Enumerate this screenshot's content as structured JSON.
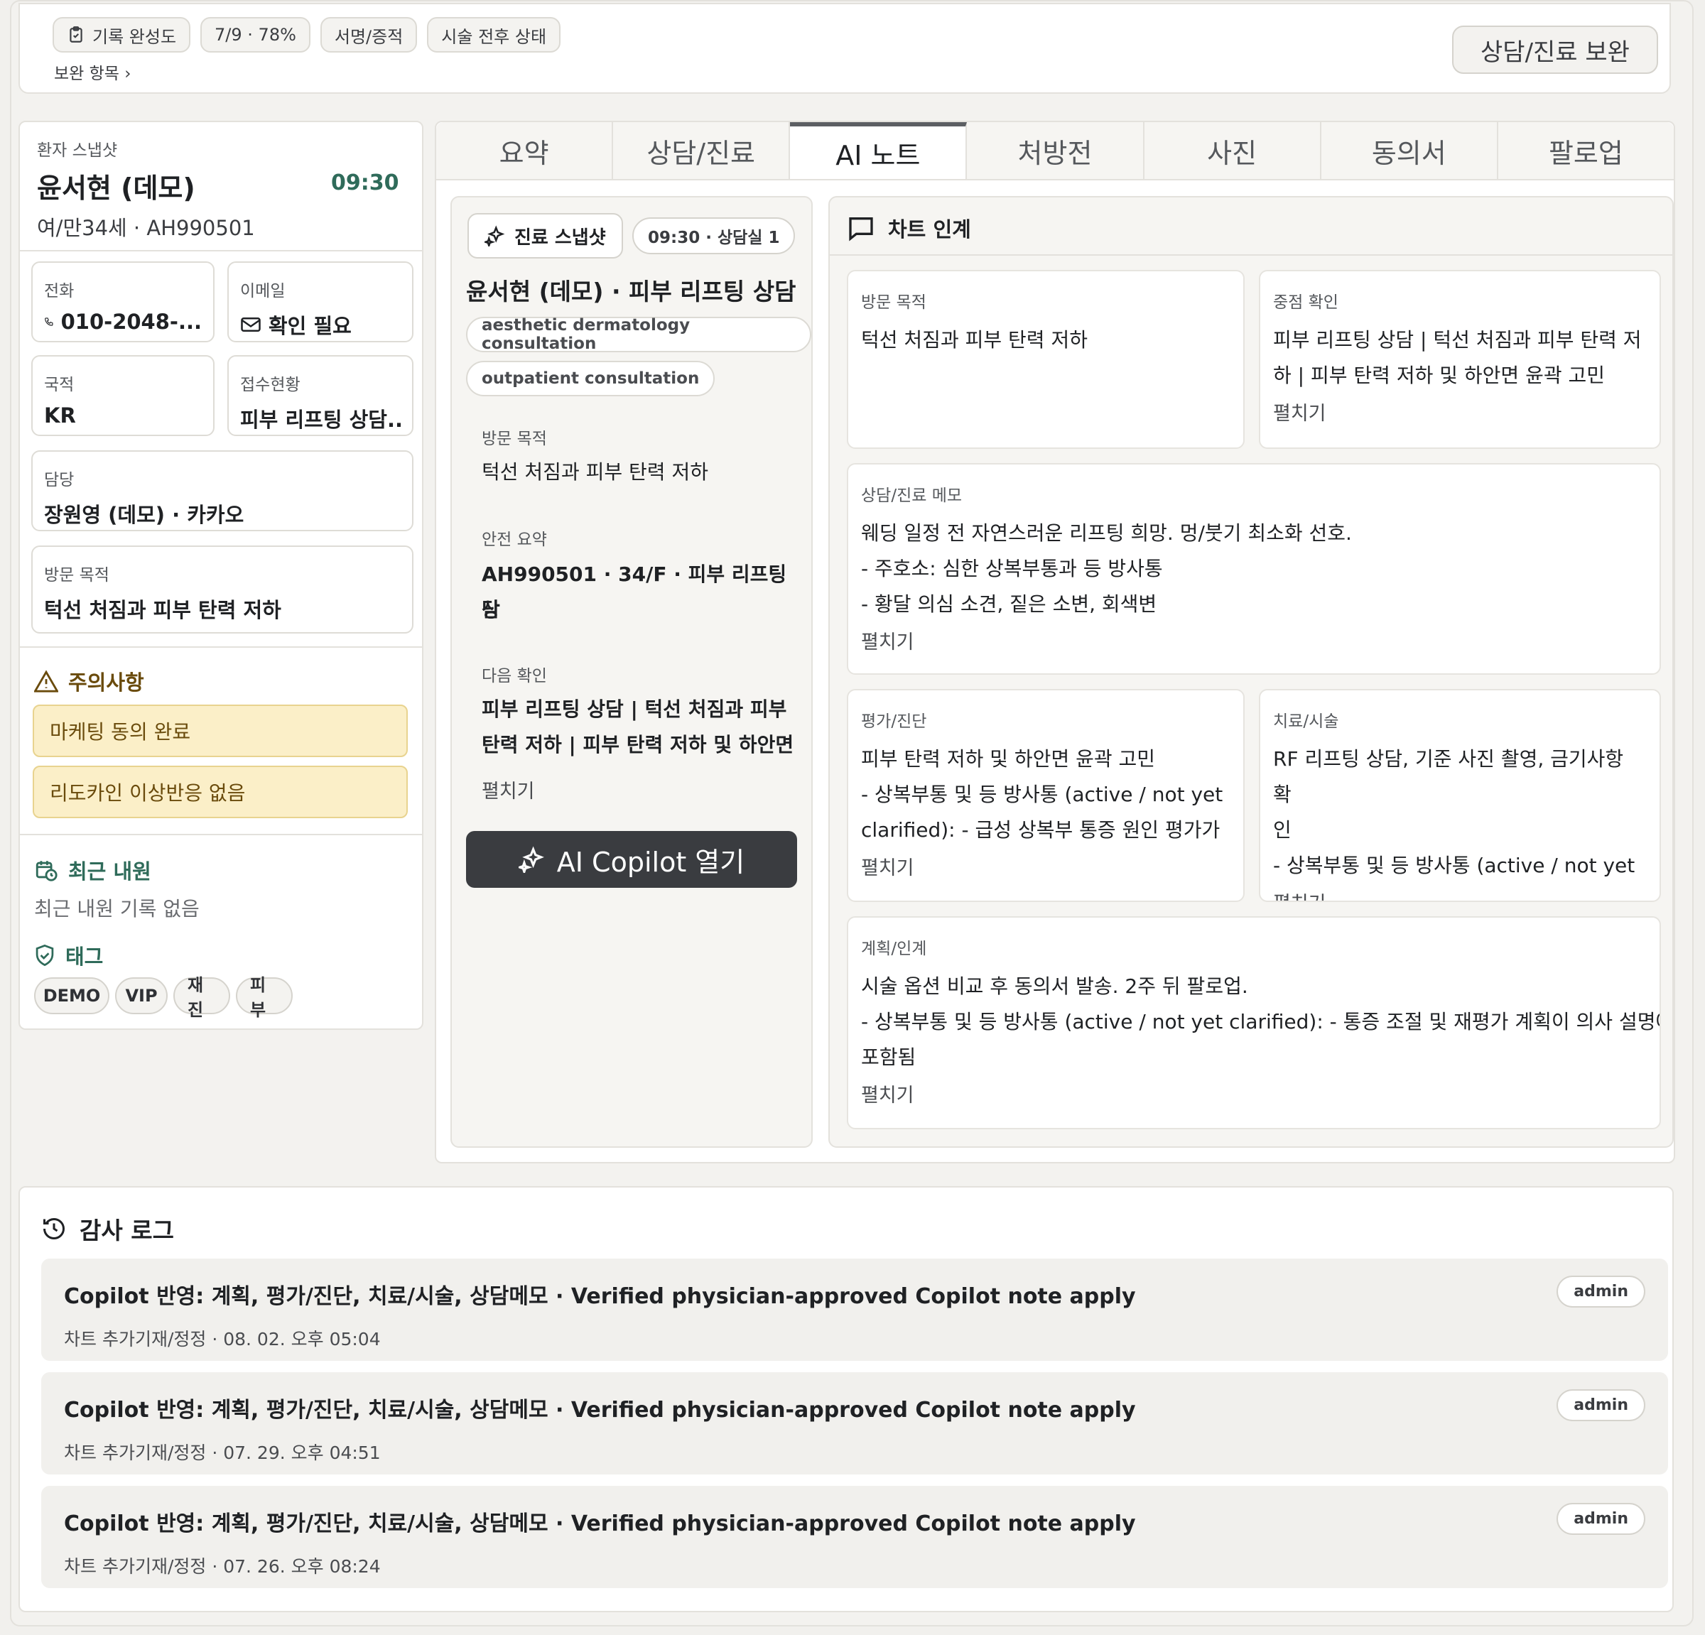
{
  "top_bar": {
    "pills": [
      "기록 완성도",
      "7/9 · 78%",
      "서명/증적",
      "시술 전후 상태"
    ],
    "supplement_link": "보완 항목 ›",
    "supplement_button": "상담/진료 보완"
  },
  "patient": {
    "section_label": "환자 스냅샷",
    "name": "윤서현 (데모)",
    "time": "09:30",
    "meta": "여/만34세 · AH990501",
    "fields": {
      "phone_label": "전화",
      "phone_value": "010-2048-...",
      "email_label": "이메일",
      "email_value": "확인 필요",
      "nationality_label": "국적",
      "nationality_value": "KR",
      "reception_label": "접수현황",
      "reception_value": "피부 리프팅 상담...",
      "staff_label": "담당",
      "staff_value": "장원영 (데모) · 카카오",
      "visit_label": "방문 목적",
      "visit_value": "턱선 처짐과 피부 탄력 저하"
    },
    "caution_title": "주의사항",
    "cautions": [
      "마케팅 동의 완료",
      "리도카인 이상반응 없음"
    ],
    "recent_title": "최근 내원",
    "recent_empty": "최근 내원 기록 없음",
    "tags_title": "태그",
    "tags": [
      "DEMO",
      "VIP",
      "재진",
      "피부"
    ]
  },
  "tabs": [
    {
      "label": "요약",
      "active": false
    },
    {
      "label": "상담/진료",
      "active": false
    },
    {
      "label": "AI 노트",
      "active": true
    },
    {
      "label": "처방전",
      "active": false
    },
    {
      "label": "사진",
      "active": false
    },
    {
      "label": "동의서",
      "active": false
    },
    {
      "label": "팔로업",
      "active": false
    }
  ],
  "snapshot": {
    "button": "진료 스냅샷",
    "badge": "09:30 · 상담실 1",
    "title": "윤서현 (데모) · 피부 리프팅 상담",
    "chips": [
      "aesthetic dermatology consultation",
      "outpatient consultation"
    ],
    "visit_label": "방문 목적",
    "visit_text": "턱선 처짐과 피부 탄력 저하",
    "safety_label": "안전 요약",
    "safety_text_1": "AH990501 · 34/F · 피부 리프팅 상",
    "safety_text_2": "담",
    "next_label": "다음 확인",
    "next_text_1": "피부 리프팅 상담 | 턱선 처짐과 피부",
    "next_text_2": "탄력 저하 | 피부 탄력 저하 및 하안면",
    "expand": "펼치기",
    "copilot_button": "AI Copilot 열기"
  },
  "handoff": {
    "title": "차트 인계",
    "visit": {
      "label": "방문 목적",
      "lines": [
        "턱선 처짐과 피부 탄력 저하"
      ]
    },
    "focus": {
      "label": "중점 확인",
      "lines": [
        "피부 리프팅 상담 | 턱선 처짐과 피부 탄력 저",
        "하 | 피부 탄력 저하 및 하안면 윤곽 고민"
      ],
      "expand": "펼치기"
    },
    "memo": {
      "label": "상담/진료 메모",
      "lines": [
        "웨딩 일정 전 자연스러운 리프팅 희망. 멍/붓기 최소화 선호.",
        "- 주호소: 심한 상복부통과 등 방사통",
        "- 황달 의심 소견, 짙은 소변, 회색변"
      ],
      "expand": "펼치기"
    },
    "assessment": {
      "label": "평가/진단",
      "lines": [
        "피부 탄력 저하 및 하안면 윤곽 고민",
        "- 상복부통 및 등 방사통 (active / not yet",
        "clarified): - 급성 상복부 통증 원인 평가가"
      ],
      "expand": "펼치기"
    },
    "treatment": {
      "label": "치료/시술",
      "lines": [
        "RF 리프팅 상담, 기준 사진 촬영, 금기사항 확",
        "인",
        "- 상복부통 및 등 방사통 (active / not yet"
      ],
      "expand": "펼치기"
    },
    "plan": {
      "label": "계획/인계",
      "lines": [
        "시술 옵션 비교 후 동의서 발송. 2주 뒤 팔로업.",
        "- 상복부통 및 등 방사통 (active / not yet clarified): - 통증 조절 및 재평가 계획이 의사 설명에",
        "포함됨"
      ],
      "expand": "펼치기"
    }
  },
  "audit": {
    "title": "감사 로그",
    "rows": [
      {
        "title": "Copilot 반영: 계획, 평가/진단, 치료/시술, 상담메모 · Verified physician-approved Copilot note apply",
        "sub": "차트 추가기재/정정 · 08. 02. 오후 05:04",
        "user": "admin"
      },
      {
        "title": "Copilot 반영: 계획, 평가/진단, 치료/시술, 상담메모 · Verified physician-approved Copilot note apply",
        "sub": "차트 추가기재/정정 · 07. 29. 오후 04:51",
        "user": "admin"
      },
      {
        "title": "Copilot 반영: 계획, 평가/진단, 치료/시술, 상담메모 · Verified physician-approved Copilot note apply",
        "sub": "차트 추가기재/정정 · 07. 26. 오후 08:24",
        "user": "admin"
      }
    ]
  },
  "colors": {
    "accent_green": "#2f6b5a",
    "caution_bg": "#fbefc8",
    "caution_text": "#6a4b0c",
    "dark_button": "#3a3c40"
  }
}
